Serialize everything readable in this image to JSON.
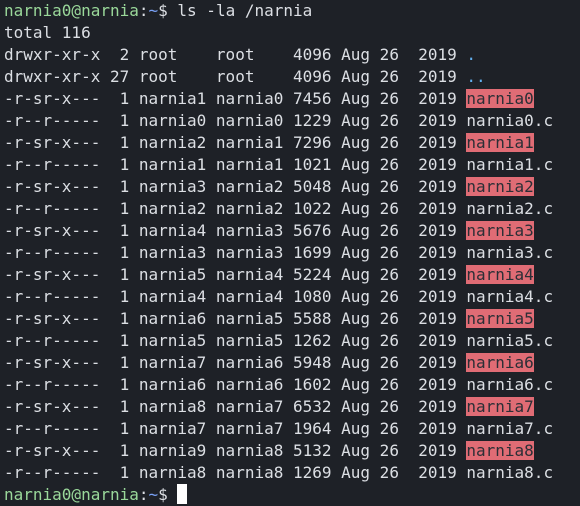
{
  "prompt": {
    "user_host": "narnia0@narnia",
    "separator": ":",
    "path": "~",
    "symbol": "$ "
  },
  "command": "ls -la /narnia",
  "total_line": "total 116",
  "colors": {
    "background": "#1e2127",
    "foreground": "#dcdfe4",
    "prompt_user": "#9ad89a",
    "prompt_path": "#7aa2f7",
    "directory": "#61afef",
    "suid_highlight": "#e06c75"
  },
  "entries": [
    {
      "prefix": "drwxr-xr-x  2 root    root    4096 Aug 26  2019 ",
      "name": ".",
      "kind": "dir"
    },
    {
      "prefix": "drwxr-xr-x 27 root    root    4096 Aug 26  2019 ",
      "name": "..",
      "kind": "dir"
    },
    {
      "prefix": "-r-sr-x---  1 narnia1 narnia0 7456 Aug 26  2019 ",
      "name": "narnia0",
      "kind": "suid"
    },
    {
      "prefix": "-r--r-----  1 narnia0 narnia0 1229 Aug 26  2019 ",
      "name": "narnia0.c",
      "kind": "file"
    },
    {
      "prefix": "-r-sr-x---  1 narnia2 narnia1 7296 Aug 26  2019 ",
      "name": "narnia1",
      "kind": "suid"
    },
    {
      "prefix": "-r--r-----  1 narnia1 narnia1 1021 Aug 26  2019 ",
      "name": "narnia1.c",
      "kind": "file"
    },
    {
      "prefix": "-r-sr-x---  1 narnia3 narnia2 5048 Aug 26  2019 ",
      "name": "narnia2",
      "kind": "suid"
    },
    {
      "prefix": "-r--r-----  1 narnia2 narnia2 1022 Aug 26  2019 ",
      "name": "narnia2.c",
      "kind": "file"
    },
    {
      "prefix": "-r-sr-x---  1 narnia4 narnia3 5676 Aug 26  2019 ",
      "name": "narnia3",
      "kind": "suid"
    },
    {
      "prefix": "-r--r-----  1 narnia3 narnia3 1699 Aug 26  2019 ",
      "name": "narnia3.c",
      "kind": "file"
    },
    {
      "prefix": "-r-sr-x---  1 narnia5 narnia4 5224 Aug 26  2019 ",
      "name": "narnia4",
      "kind": "suid"
    },
    {
      "prefix": "-r--r-----  1 narnia4 narnia4 1080 Aug 26  2019 ",
      "name": "narnia4.c",
      "kind": "file"
    },
    {
      "prefix": "-r-sr-x---  1 narnia6 narnia5 5588 Aug 26  2019 ",
      "name": "narnia5",
      "kind": "suid"
    },
    {
      "prefix": "-r--r-----  1 narnia5 narnia5 1262 Aug 26  2019 ",
      "name": "narnia5.c",
      "kind": "file"
    },
    {
      "prefix": "-r-sr-x---  1 narnia7 narnia6 5948 Aug 26  2019 ",
      "name": "narnia6",
      "kind": "suid"
    },
    {
      "prefix": "-r--r-----  1 narnia6 narnia6 1602 Aug 26  2019 ",
      "name": "narnia6.c",
      "kind": "file"
    },
    {
      "prefix": "-r-sr-x---  1 narnia8 narnia7 6532 Aug 26  2019 ",
      "name": "narnia7",
      "kind": "suid"
    },
    {
      "prefix": "-r--r-----  1 narnia7 narnia7 1964 Aug 26  2019 ",
      "name": "narnia7.c",
      "kind": "file"
    },
    {
      "prefix": "-r-sr-x---  1 narnia9 narnia8 5132 Aug 26  2019 ",
      "name": "narnia8",
      "kind": "suid"
    },
    {
      "prefix": "-r--r-----  1 narnia8 narnia8 1269 Aug 26  2019 ",
      "name": "narnia8.c",
      "kind": "file"
    }
  ]
}
